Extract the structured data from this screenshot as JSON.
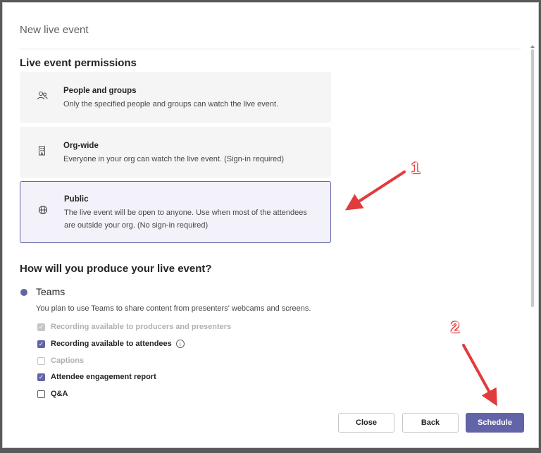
{
  "dialog": {
    "title": "New live event"
  },
  "permissions": {
    "heading": "Live event permissions",
    "options": [
      {
        "title": "People and groups",
        "description": "Only the specified people and groups can watch the live event.",
        "icon": "people-icon",
        "selected": false
      },
      {
        "title": "Org-wide",
        "description": "Everyone in your org can watch the live event. (Sign-in required)",
        "icon": "building-icon",
        "selected": false
      },
      {
        "title": "Public",
        "description": "The live event will be open to anyone. Use when most of the attendees are outside your org. (No sign-in required)",
        "icon": "globe-icon",
        "selected": true
      }
    ]
  },
  "produce": {
    "heading": "How will you produce your live event?",
    "radio_label": "Teams",
    "radio_description": "You plan to use Teams to share content from presenters' webcams and screens.",
    "checkboxes": [
      {
        "label": "Recording available to producers and presenters",
        "checked": true,
        "disabled": true
      },
      {
        "label": "Recording available to attendees",
        "checked": true,
        "disabled": false
      },
      {
        "label": "Captions",
        "checked": false,
        "disabled": true
      },
      {
        "label": "Attendee engagement report",
        "checked": true,
        "disabled": false
      },
      {
        "label": "Q&A",
        "checked": false,
        "disabled": false
      }
    ]
  },
  "footer": {
    "close_label": "Close",
    "back_label": "Back",
    "schedule_label": "Schedule"
  },
  "annotations": {
    "marker_1": "1",
    "marker_2": "2"
  },
  "colors": {
    "accent": "#6264a7",
    "annotation": "#e23b3b"
  }
}
